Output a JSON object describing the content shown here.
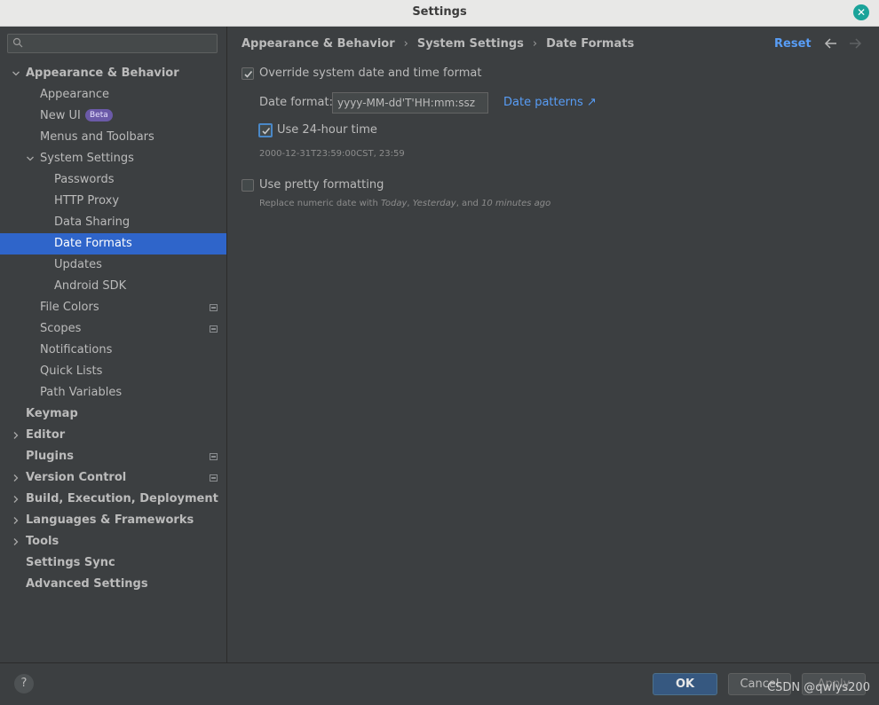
{
  "window": {
    "title": "Settings"
  },
  "sidebar": {
    "search_placeholder": "",
    "items": [
      {
        "label": "Appearance & Behavior",
        "level": 0,
        "bold": true,
        "expanded": true,
        "has_arrow": true,
        "selected": false,
        "gear": false,
        "beta": false
      },
      {
        "label": "Appearance",
        "level": 1,
        "bold": false,
        "has_arrow": false,
        "selected": false,
        "gear": false,
        "beta": false
      },
      {
        "label": "New UI",
        "level": 1,
        "bold": false,
        "has_arrow": false,
        "selected": false,
        "gear": false,
        "beta": true
      },
      {
        "label": "Menus and Toolbars",
        "level": 1,
        "bold": false,
        "has_arrow": false,
        "selected": false,
        "gear": false,
        "beta": false
      },
      {
        "label": "System Settings",
        "level": 1,
        "bold": false,
        "expanded": true,
        "has_arrow": true,
        "selected": false,
        "gear": false,
        "beta": false
      },
      {
        "label": "Passwords",
        "level": 2,
        "bold": false,
        "has_arrow": false,
        "selected": false,
        "gear": false,
        "beta": false
      },
      {
        "label": "HTTP Proxy",
        "level": 2,
        "bold": false,
        "has_arrow": false,
        "selected": false,
        "gear": false,
        "beta": false
      },
      {
        "label": "Data Sharing",
        "level": 2,
        "bold": false,
        "has_arrow": false,
        "selected": false,
        "gear": false,
        "beta": false
      },
      {
        "label": "Date Formats",
        "level": 2,
        "bold": false,
        "has_arrow": false,
        "selected": true,
        "gear": false,
        "beta": false
      },
      {
        "label": "Updates",
        "level": 2,
        "bold": false,
        "has_arrow": false,
        "selected": false,
        "gear": false,
        "beta": false
      },
      {
        "label": "Android SDK",
        "level": 2,
        "bold": false,
        "has_arrow": false,
        "selected": false,
        "gear": false,
        "beta": false
      },
      {
        "label": "File Colors",
        "level": 1,
        "bold": false,
        "has_arrow": false,
        "selected": false,
        "gear": true,
        "beta": false
      },
      {
        "label": "Scopes",
        "level": 1,
        "bold": false,
        "has_arrow": false,
        "selected": false,
        "gear": true,
        "beta": false
      },
      {
        "label": "Notifications",
        "level": 1,
        "bold": false,
        "has_arrow": false,
        "selected": false,
        "gear": false,
        "beta": false
      },
      {
        "label": "Quick Lists",
        "level": 1,
        "bold": false,
        "has_arrow": false,
        "selected": false,
        "gear": false,
        "beta": false
      },
      {
        "label": "Path Variables",
        "level": 1,
        "bold": false,
        "has_arrow": false,
        "selected": false,
        "gear": false,
        "beta": false
      },
      {
        "label": "Keymap",
        "level": 0,
        "bold": true,
        "has_arrow": false,
        "selected": false,
        "gear": false,
        "beta": false
      },
      {
        "label": "Editor",
        "level": 0,
        "bold": true,
        "expanded": false,
        "has_arrow": true,
        "selected": false,
        "gear": false,
        "beta": false
      },
      {
        "label": "Plugins",
        "level": 0,
        "bold": true,
        "has_arrow": false,
        "selected": false,
        "gear": true,
        "beta": false
      },
      {
        "label": "Version Control",
        "level": 0,
        "bold": true,
        "expanded": false,
        "has_arrow": true,
        "selected": false,
        "gear": true,
        "beta": false
      },
      {
        "label": "Build, Execution, Deployment",
        "level": 0,
        "bold": true,
        "expanded": false,
        "has_arrow": true,
        "selected": false,
        "gear": false,
        "beta": false
      },
      {
        "label": "Languages & Frameworks",
        "level": 0,
        "bold": true,
        "expanded": false,
        "has_arrow": true,
        "selected": false,
        "gear": false,
        "beta": false
      },
      {
        "label": "Tools",
        "level": 0,
        "bold": true,
        "expanded": false,
        "has_arrow": true,
        "selected": false,
        "gear": false,
        "beta": false
      },
      {
        "label": "Settings Sync",
        "level": 0,
        "bold": true,
        "has_arrow": false,
        "selected": false,
        "gear": false,
        "beta": false
      },
      {
        "label": "Advanced Settings",
        "level": 0,
        "bold": true,
        "has_arrow": false,
        "selected": false,
        "gear": false,
        "beta": false
      }
    ],
    "beta_label": "Beta"
  },
  "content": {
    "breadcrumb": [
      "Appearance & Behavior",
      "System Settings",
      "Date Formats"
    ],
    "breadcrumb_separator": "›",
    "reset_label": "Reset",
    "override": {
      "label": "Override system date and time format",
      "checked": true
    },
    "date_format": {
      "label": "Date format:",
      "value": "yyyy-MM-dd'T'HH:mm:ssz"
    },
    "date_patterns_link": "Date patterns ↗",
    "use_24_hour": {
      "label": "Use 24-hour time",
      "checked": true
    },
    "preview": "2000-12-31T23:59:00CST, 23:59",
    "pretty": {
      "label": "Use pretty formatting",
      "checked": false,
      "hint_prefix": "Replace numeric date with ",
      "hint_today": "Today",
      "hint_comma": ", ",
      "hint_yesterday": "Yesterday",
      "hint_and": ", and ",
      "hint_minutes": "10 minutes ago"
    }
  },
  "footer": {
    "help_label": "?",
    "ok_label": "OK",
    "cancel_label": "Cancel",
    "apply_label": "Apply",
    "watermark": "CSDN @qwlys200"
  },
  "colors": {
    "selection": "#2f65ca",
    "link": "#589df6",
    "ok_button": "#365880",
    "close_button": "#1aa39a"
  }
}
